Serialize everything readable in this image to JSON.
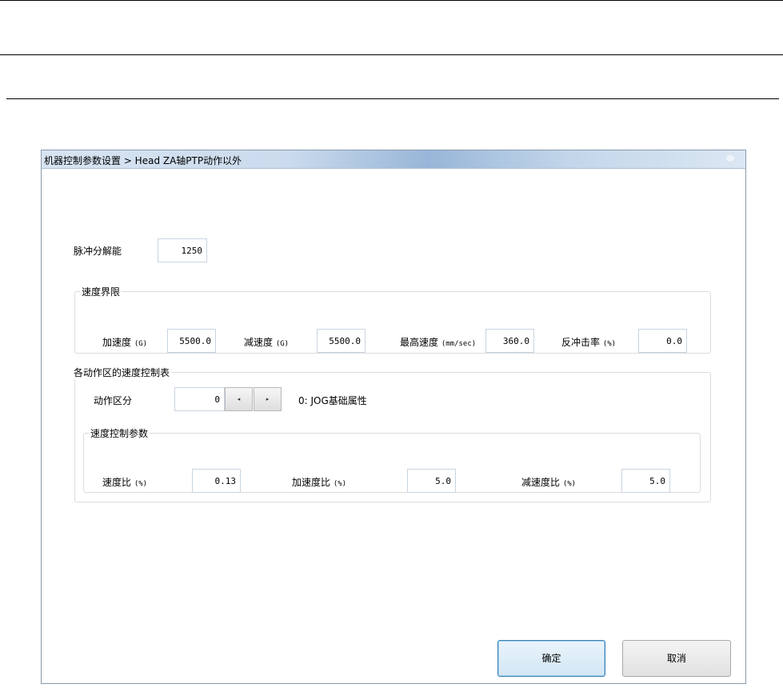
{
  "window": {
    "title": "机器控制参数设置 > Head ZA轴PTP动作以外"
  },
  "pulse_resolution": {
    "label": "脉冲分解能",
    "value": "1250"
  },
  "speed_limit": {
    "caption": "速度界限",
    "accel": {
      "label": "加速度",
      "unit": "(G)",
      "value": "5500.0"
    },
    "decel": {
      "label": "减速度",
      "unit": "(G)",
      "value": "5500.0"
    },
    "max_speed": {
      "label": "最高速度",
      "unit": "(mm/sec)",
      "value": "360.0"
    },
    "jerk": {
      "label": "反冲击率",
      "unit": "(%)",
      "value": "0.0"
    }
  },
  "zone_table": {
    "caption": "各动作区的速度控制表",
    "zone_label": "动作区分",
    "zone_value": "0",
    "prev_glyph": "◂",
    "next_glyph": "▸",
    "zone_description": "0: JOG基础属性",
    "params": {
      "caption": "速度控制参数",
      "speed_ratio": {
        "label": "速度比",
        "unit": "(%)",
        "value": "0.13"
      },
      "accel_ratio": {
        "label": "加速度比",
        "unit": "(%)",
        "value": "5.0"
      },
      "decel_ratio": {
        "label": "减速度比",
        "unit": "(%)",
        "value": "5.0"
      }
    }
  },
  "buttons": {
    "ok": "确定",
    "cancel": "取消"
  }
}
